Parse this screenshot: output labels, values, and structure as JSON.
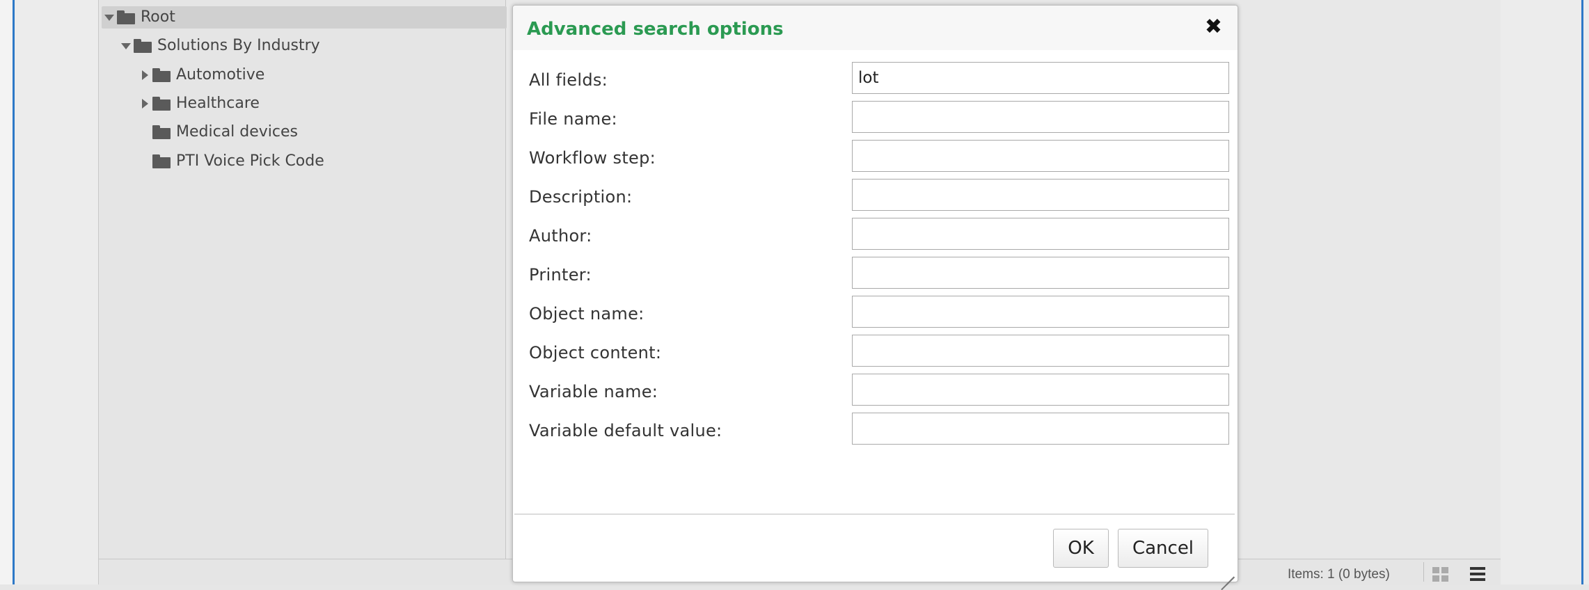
{
  "tree": {
    "items": [
      {
        "label": "Root",
        "expander": "expanded",
        "selected": true
      },
      {
        "label": "Solutions By Industry",
        "expander": "expanded",
        "selected": false
      },
      {
        "label": "Automotive",
        "expander": "collapsed",
        "selected": false
      },
      {
        "label": "Healthcare",
        "expander": "collapsed",
        "selected": false
      },
      {
        "label": "Medical devices",
        "expander": "none",
        "selected": false
      },
      {
        "label": "PTI Voice Pick Code",
        "expander": "none",
        "selected": false
      }
    ]
  },
  "dialog": {
    "title": "Advanced search options",
    "close_icon": "close-icon",
    "fields": [
      {
        "label": "All fields:",
        "value": "lot"
      },
      {
        "label": "File name:",
        "value": ""
      },
      {
        "label": "Workflow step:",
        "value": ""
      },
      {
        "label": "Description:",
        "value": ""
      },
      {
        "label": "Author:",
        "value": ""
      },
      {
        "label": "Printer:",
        "value": ""
      },
      {
        "label": "Object name:",
        "value": ""
      },
      {
        "label": "Object content:",
        "value": ""
      },
      {
        "label": "Variable name:",
        "value": ""
      },
      {
        "label": "Variable default value:",
        "value": ""
      }
    ],
    "ok_label": "OK",
    "cancel_label": "Cancel"
  },
  "statusbar": {
    "items_text": "Items: 1 (0 bytes)",
    "icons": [
      "grid-view-icon",
      "list-view-icon"
    ]
  },
  "colors": {
    "title_green": "#2b9a52",
    "window_edge_blue": "#2e79c7"
  }
}
